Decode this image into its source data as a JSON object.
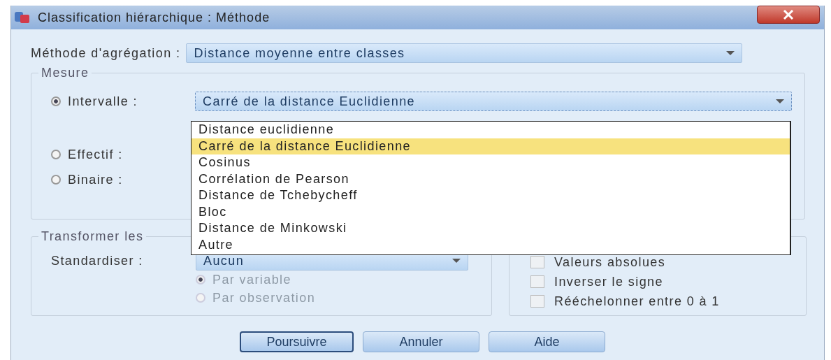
{
  "window": {
    "title": "Classification hiérarchique : Méthode"
  },
  "aggregation": {
    "label": "Méthode d'agrégation :",
    "value": "Distance moyenne entre classes"
  },
  "measure": {
    "legend": "Mesure",
    "metric": "Carré de la distance Euclidienne",
    "options": [
      {
        "label": "Intervalle :",
        "selected": true
      },
      {
        "label": "Effectif :",
        "selected": false
      },
      {
        "label": "Binaire :",
        "selected": false
      }
    ]
  },
  "dropdown": {
    "items": [
      {
        "label": "Distance euclidienne",
        "selected": false
      },
      {
        "label": "Carré de la distance Euclidienne",
        "selected": true
      },
      {
        "label": "Cosinus",
        "selected": false
      },
      {
        "label": "Corrélation de Pearson",
        "selected": false
      },
      {
        "label": "Distance de Tchebycheff",
        "selected": false
      },
      {
        "label": "Bloc",
        "selected": false
      },
      {
        "label": "Distance de Minkowski",
        "selected": false
      },
      {
        "label": "Autre",
        "selected": false
      }
    ]
  },
  "transform": {
    "legend": "Transformer les",
    "standardize": {
      "label": "Standardiser :",
      "value": "Aucun"
    },
    "scope": [
      {
        "label": "Par variable",
        "selected": true,
        "disabled": true
      },
      {
        "label": "Par observation",
        "selected": false,
        "disabled": true
      }
    ]
  },
  "checkboxes": [
    {
      "label": "Valeurs absolues",
      "checked": false
    },
    {
      "label": "Inverser le signe",
      "checked": false
    },
    {
      "label": "Rééchelonner entre 0 à 1",
      "checked": false
    }
  ],
  "buttons": [
    {
      "label": "Poursuivre",
      "default": true
    },
    {
      "label": "Annuler",
      "default": false
    },
    {
      "label": "Aide",
      "default": false
    }
  ]
}
